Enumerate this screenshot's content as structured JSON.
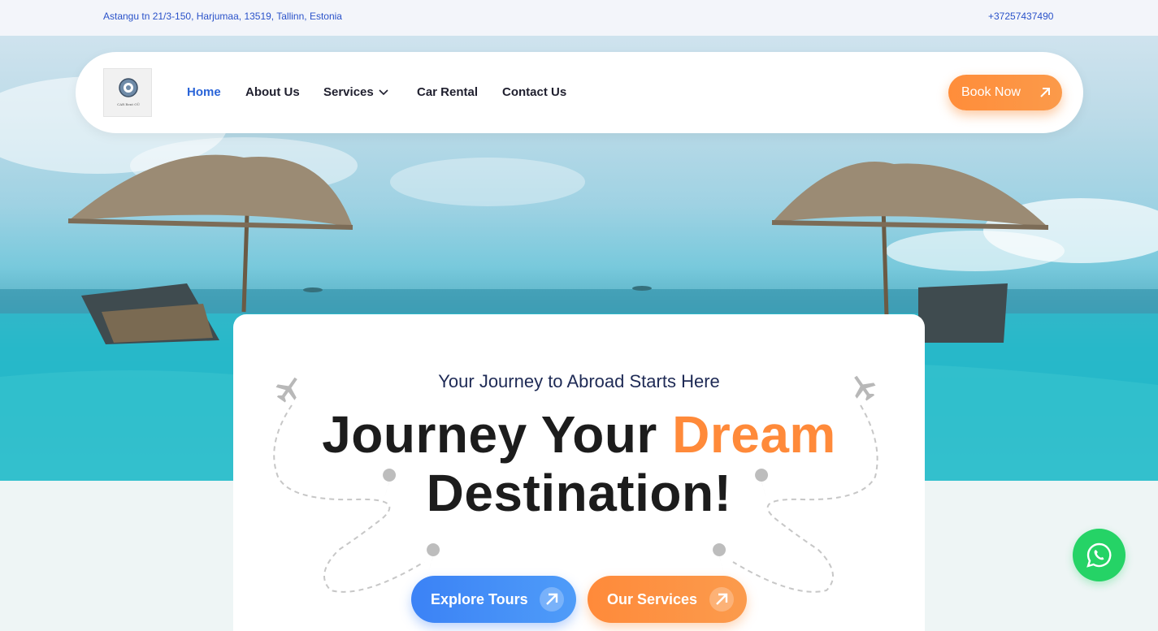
{
  "topbar": {
    "address": "Astangu tn 21/3-150, Harjumaa, 13519, Tallinn, Estonia",
    "phone": "+37257437490"
  },
  "logo": {
    "text": "CAR Rent OÜ"
  },
  "nav": {
    "items": [
      "Home",
      "About Us",
      "Services",
      "Car Rental",
      "Contact Us"
    ],
    "active": "Home",
    "book_now": "Book Now"
  },
  "hero": {
    "subtitle": "Your Journey to Abroad Starts Here",
    "headline_part1": "Journey Your",
    "headline_accent": "Dream",
    "headline_part2": "Destination!",
    "explore_tours": "Explore Tours",
    "our_services": "Our Services"
  },
  "colors": {
    "accent_orange": "#ff8a3a",
    "accent_blue": "#3b82f6",
    "nav_active": "#2a64d8",
    "whatsapp": "#25d366"
  }
}
